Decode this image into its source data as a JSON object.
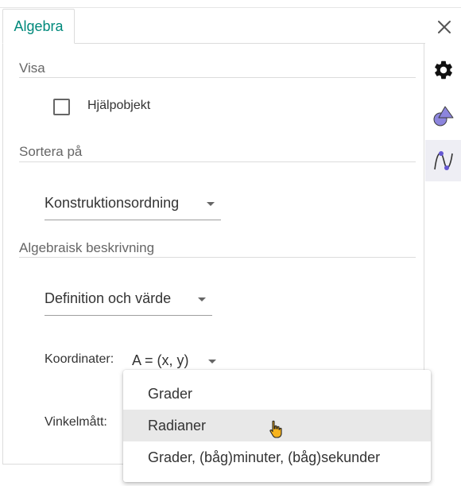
{
  "tab": {
    "label": "Algebra"
  },
  "sections": {
    "show": {
      "title": "Visa",
      "checkbox_label": "Hjälpobjekt",
      "checked": false
    },
    "sort": {
      "title": "Sortera på",
      "dropdown_value": "Konstruktionsordning"
    },
    "description": {
      "title": "Algebraisk beskrivning",
      "dropdown_value": "Definition och värde"
    }
  },
  "coordinates": {
    "label": "Koordinater:",
    "value": "A = (x, y)"
  },
  "angle": {
    "label": "Vinkelmått:"
  },
  "menu": {
    "items": [
      "Grader",
      "Radianer",
      "Grader, (båg)minuter, (båg)sekunder"
    ],
    "hovered_index": 1
  },
  "icons": {
    "close": "close-icon",
    "settings": "gear-icon",
    "graphics": "geometry-shapes-icon",
    "algebra": "function-graph-icon"
  },
  "colors": {
    "accent": "#00897b",
    "icon_purple": "#6557d2",
    "menu_hover": "#e8e8e8"
  }
}
